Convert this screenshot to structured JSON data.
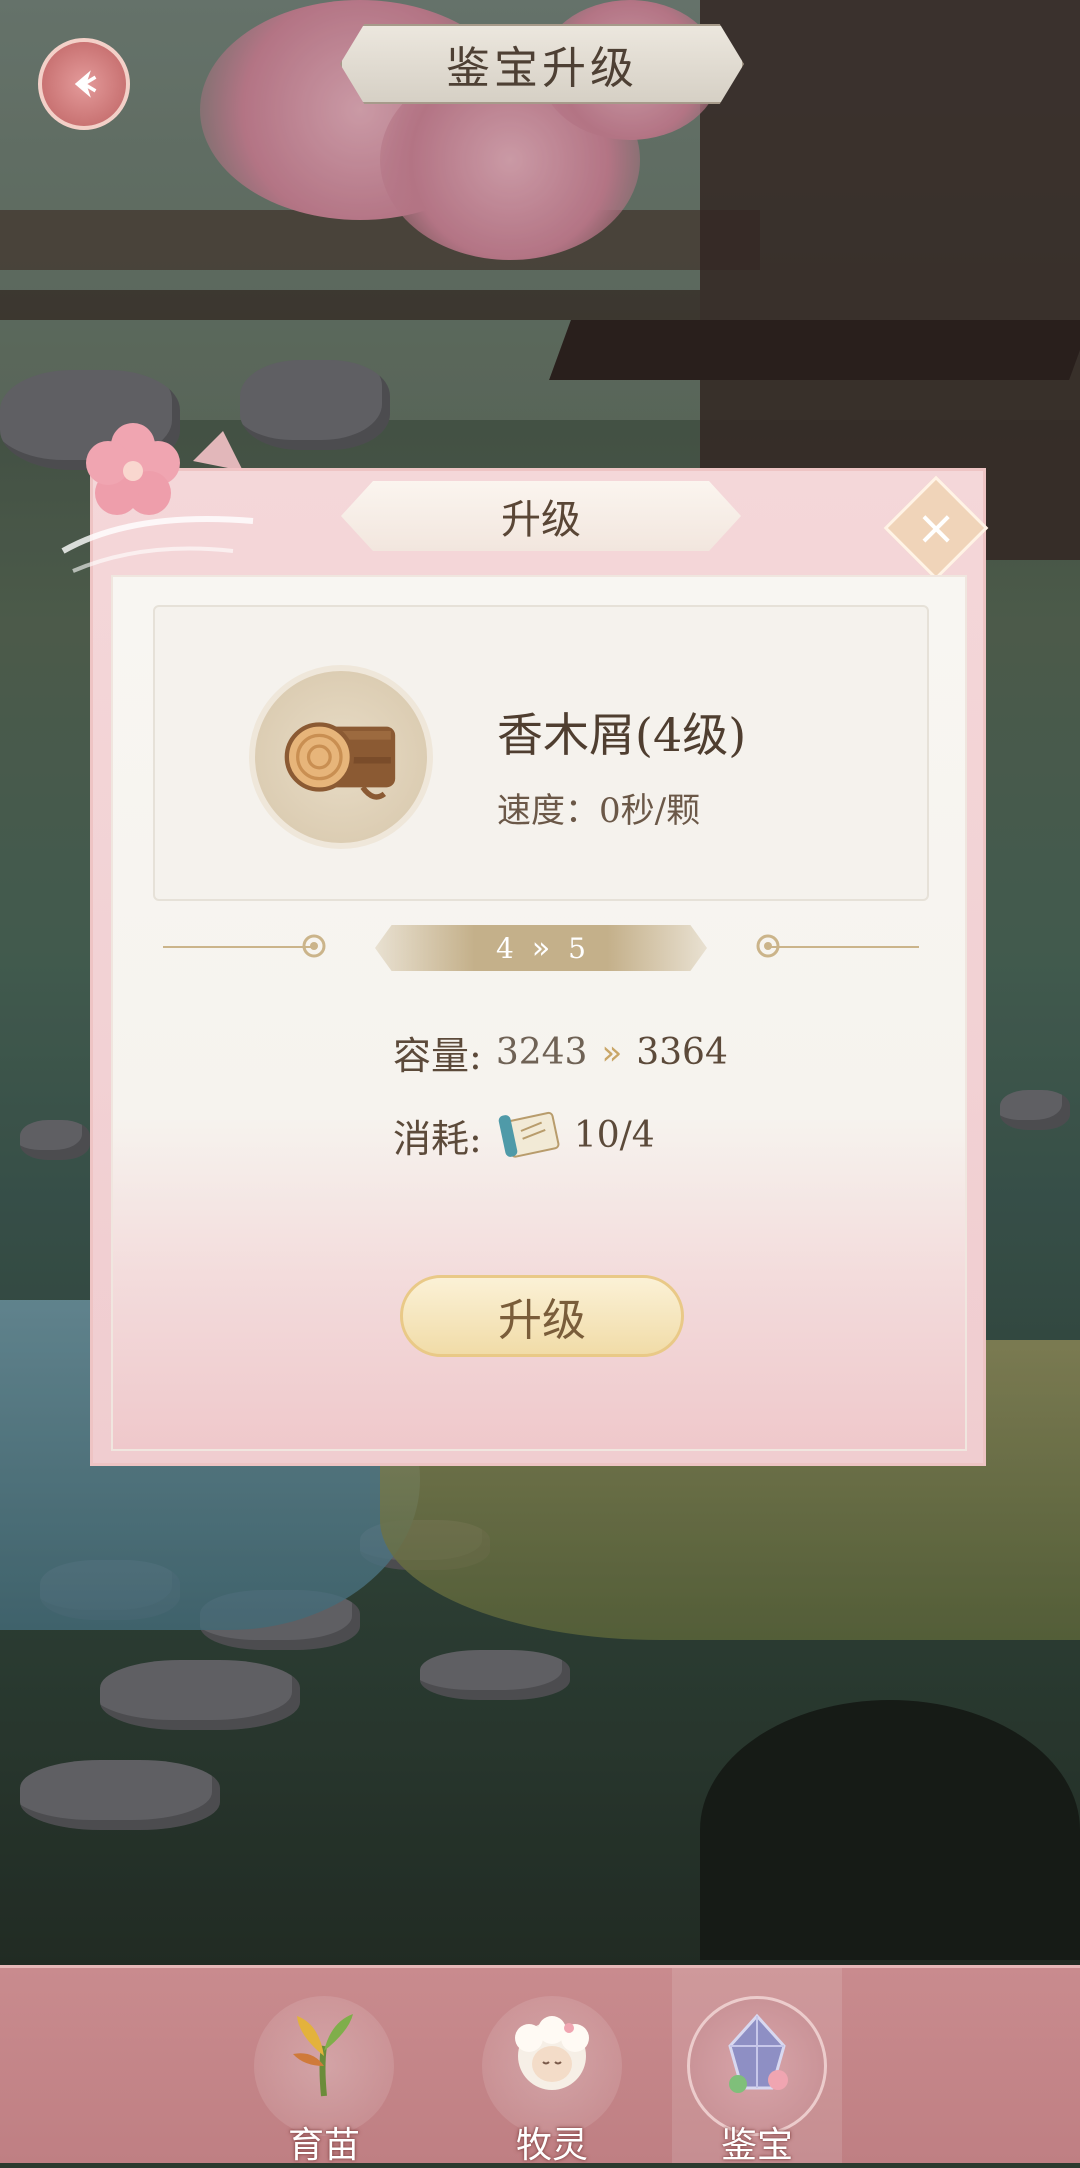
{
  "header": {
    "title": "鉴宝升级"
  },
  "dialog": {
    "title": "升级",
    "item": {
      "name": "香木屑(4级)",
      "speed": "速度：0秒/颗",
      "icon": "wood-log-icon"
    },
    "level": {
      "from": "4",
      "to": "5"
    },
    "capacity": {
      "label": "容量:",
      "old": "3243",
      "new": "3364"
    },
    "cost": {
      "label": "消耗:",
      "icon": "scroll-icon",
      "value": "10/4"
    },
    "upgrade_button": "升级"
  },
  "bottom_nav": {
    "tabs": [
      {
        "label": "育苗",
        "icon": "sprout-icon"
      },
      {
        "label": "牧灵",
        "icon": "sheep-icon"
      },
      {
        "label": "鉴宝",
        "icon": "gem-icon"
      }
    ],
    "active_tab": "鉴宝"
  },
  "colors": {
    "dialog_pink": "#f0cdd0",
    "accent_gold": "#c9a667",
    "text_brown": "#4f3e30",
    "nav_pink": "#c98b8e"
  }
}
